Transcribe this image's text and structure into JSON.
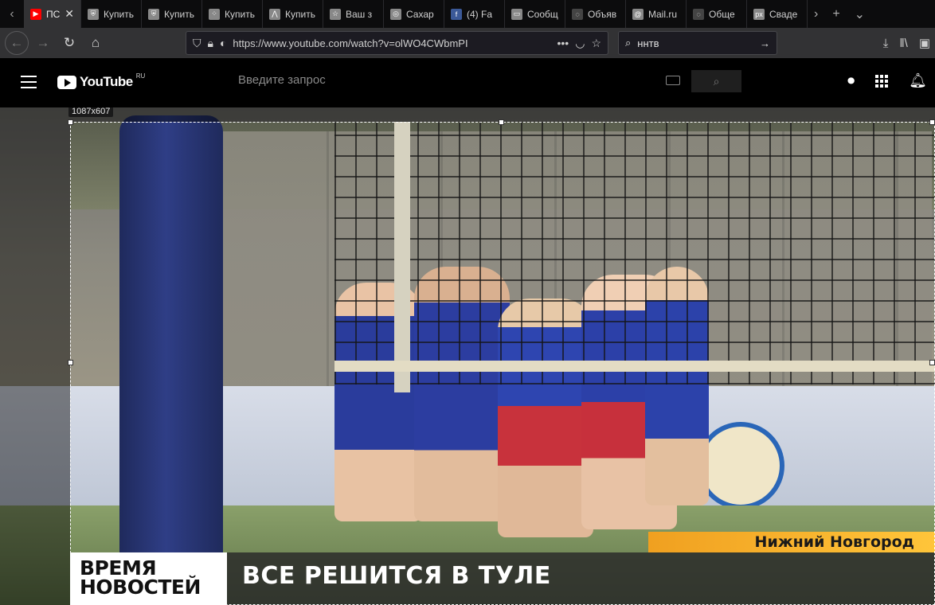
{
  "browser": {
    "tabs": [
      {
        "label": "ПС",
        "icon": "youtube-icon",
        "color": "#ff0000",
        "active": true
      },
      {
        "label": "Купить",
        "icon": "shield-icon",
        "color": "#888888"
      },
      {
        "label": "Купить",
        "icon": "shield-icon",
        "color": "#888888"
      },
      {
        "label": "Купить",
        "icon": "dots-icon",
        "color": "#888888"
      },
      {
        "label": "Купить",
        "icon": "mountain-icon",
        "color": "#888888"
      },
      {
        "label": "Ваш з",
        "icon": "star-icon",
        "color": "#888888"
      },
      {
        "label": "Сахар",
        "icon": "instagram-icon",
        "color": "#888888"
      },
      {
        "label": "(4) Fa",
        "icon": "facebook-icon",
        "color": "#3b5998"
      },
      {
        "label": "Сообщ",
        "icon": "chat-icon",
        "color": "#888888"
      },
      {
        "label": "Объяв",
        "icon": "generic-icon",
        "color": "#444444"
      },
      {
        "label": "Mail.ru",
        "icon": "at-icon",
        "color": "#888888"
      },
      {
        "label": "Обще",
        "icon": "generic-icon",
        "color": "#444444"
      },
      {
        "label": "Сваде",
        "icon": "px-icon",
        "color": "#888888"
      }
    ],
    "close_tab": "✕",
    "new_tab": "+",
    "url": "https://www.youtube.com/watch?v=olWO4CWbmPI",
    "search_query": "ннтв"
  },
  "youtube": {
    "logo_text": "YouTube",
    "logo_region": "RU",
    "search_placeholder": "Введите запрос"
  },
  "screenshot_tool": {
    "size_label": "1087x607"
  },
  "video": {
    "location": "Нижний Новгород",
    "show_logo_line1": "ВРЕМЯ",
    "show_logo_line2": "НОВОСТЕЙ",
    "headline": "ВСЕ РЕШИТСЯ В ТУЛЕ"
  }
}
